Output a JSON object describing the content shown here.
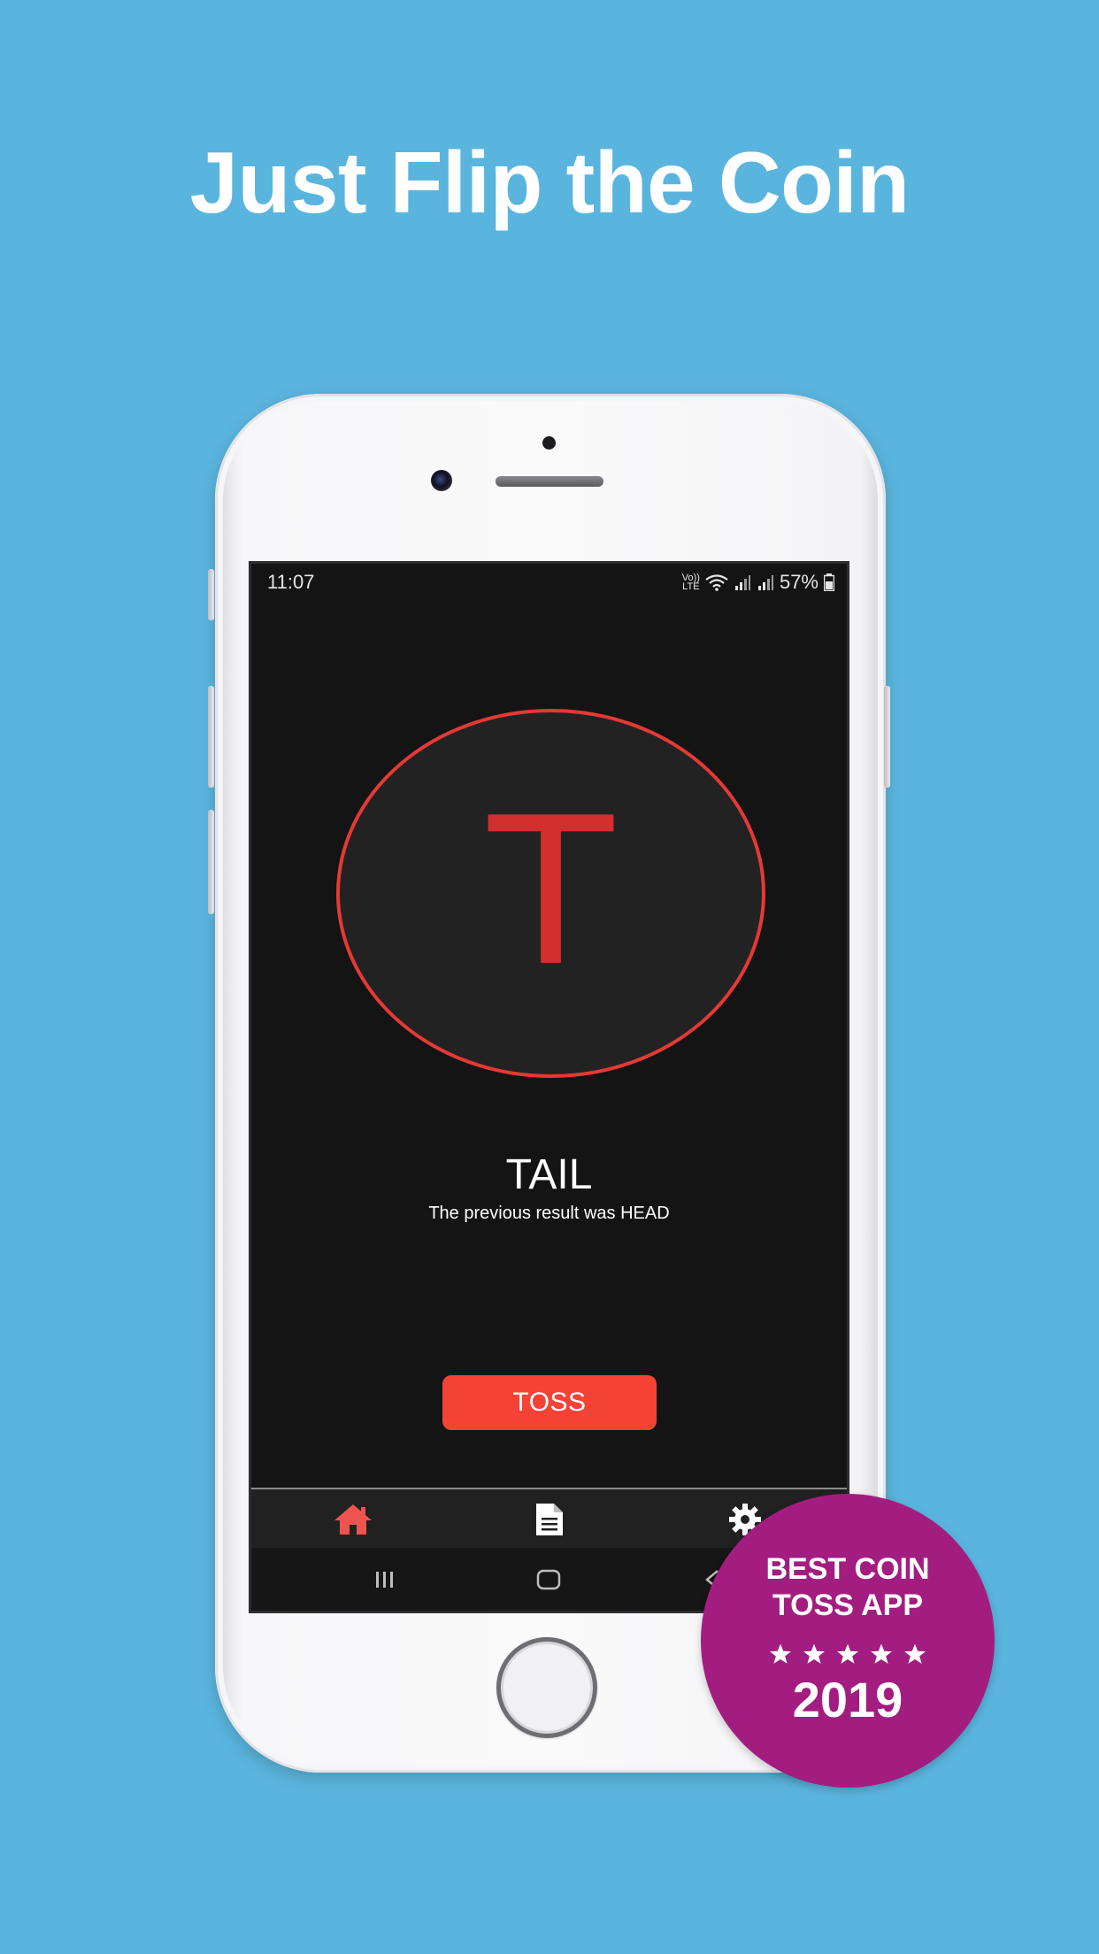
{
  "headline": "Just Flip the Coin",
  "status_bar": {
    "time": "11:07",
    "network_label_top": "Vo))",
    "network_label_bottom": "LTE",
    "battery": "57%"
  },
  "coin": {
    "letter": "T"
  },
  "result": {
    "title": "TAIL",
    "previous": "The previous result was HEAD"
  },
  "toss_button": {
    "label": "TOSS"
  },
  "bottom_nav": {
    "items": [
      {
        "icon": "home-icon",
        "active": true,
        "color": "#ef5350"
      },
      {
        "icon": "document-icon",
        "active": false,
        "color": "#ffffff"
      },
      {
        "icon": "gear-icon",
        "active": false,
        "color": "#ffffff"
      }
    ]
  },
  "badge": {
    "line1": "BEST COIN",
    "line2": "TOSS APP",
    "stars": 5,
    "year": "2019"
  },
  "colors": {
    "background": "#5ab5de",
    "accent": "#f44336",
    "coin_border": "#e53935",
    "badge": "#a31d80"
  }
}
